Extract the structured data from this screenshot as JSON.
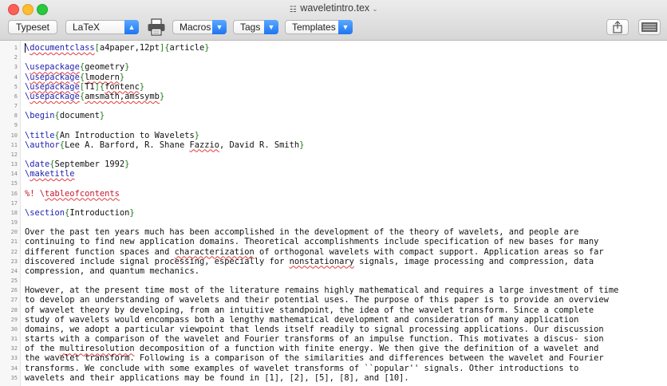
{
  "window": {
    "title": "waveletintro.tex"
  },
  "toolbar": {
    "typeset_label": "Typeset",
    "engine_value": "LaTeX",
    "macros_label": "Macros",
    "tags_label": "Tags",
    "templates_label": "Templates"
  },
  "editor": {
    "lines": [
      {
        "num": "1",
        "parts": [
          {
            "cls": "cmd",
            "t": "\\"
          },
          {
            "cls": "cmd squig",
            "t": "documentclass"
          },
          {
            "cls": "brace",
            "t": "["
          },
          {
            "cls": "arg",
            "t": "a4paper,12pt"
          },
          {
            "cls": "brace",
            "t": "]{"
          },
          {
            "cls": "arg",
            "t": "article"
          },
          {
            "cls": "brace",
            "t": "}"
          }
        ]
      },
      {
        "num": "2",
        "parts": []
      },
      {
        "num": "3",
        "parts": [
          {
            "cls": "cmd",
            "t": "\\"
          },
          {
            "cls": "cmd squig",
            "t": "usepackage"
          },
          {
            "cls": "brace",
            "t": "{"
          },
          {
            "cls": "arg",
            "t": "geometry"
          },
          {
            "cls": "brace",
            "t": "}"
          }
        ]
      },
      {
        "num": "4",
        "parts": [
          {
            "cls": "cmd",
            "t": "\\"
          },
          {
            "cls": "cmd squig",
            "t": "usepackage"
          },
          {
            "cls": "brace",
            "t": "{"
          },
          {
            "cls": "arg squig",
            "t": "lmodern"
          },
          {
            "cls": "brace",
            "t": "}"
          }
        ]
      },
      {
        "num": "5",
        "parts": [
          {
            "cls": "cmd",
            "t": "\\"
          },
          {
            "cls": "cmd squig",
            "t": "usepackage"
          },
          {
            "cls": "brace",
            "t": "["
          },
          {
            "cls": "arg",
            "t": "T1"
          },
          {
            "cls": "brace",
            "t": "]{"
          },
          {
            "cls": "arg squig",
            "t": "fontenc"
          },
          {
            "cls": "brace",
            "t": "}"
          }
        ]
      },
      {
        "num": "6",
        "parts": [
          {
            "cls": "cmd",
            "t": "\\"
          },
          {
            "cls": "cmd squig",
            "t": "usepackage"
          },
          {
            "cls": "brace",
            "t": "{"
          },
          {
            "cls": "arg squig",
            "t": "amsmath,amssymb"
          },
          {
            "cls": "brace",
            "t": "}"
          }
        ]
      },
      {
        "num": "7",
        "parts": []
      },
      {
        "num": "8",
        "parts": [
          {
            "cls": "cmd",
            "t": "\\begin"
          },
          {
            "cls": "brace",
            "t": "{"
          },
          {
            "cls": "arg",
            "t": "document"
          },
          {
            "cls": "brace",
            "t": "}"
          }
        ]
      },
      {
        "num": "9",
        "parts": []
      },
      {
        "num": "10",
        "parts": [
          {
            "cls": "cmd",
            "t": "\\title"
          },
          {
            "cls": "brace",
            "t": "{"
          },
          {
            "cls": "arg",
            "t": "An Introduction to Wavelets"
          },
          {
            "cls": "brace",
            "t": "}"
          }
        ]
      },
      {
        "num": "11",
        "parts": [
          {
            "cls": "cmd",
            "t": "\\author"
          },
          {
            "cls": "brace",
            "t": "{"
          },
          {
            "cls": "arg",
            "t": "Lee A. Barford, R. Shane "
          },
          {
            "cls": "arg squig",
            "t": "Fazzio"
          },
          {
            "cls": "arg",
            "t": ", David R. Smith"
          },
          {
            "cls": "brace",
            "t": "}"
          }
        ]
      },
      {
        "num": "12",
        "parts": []
      },
      {
        "num": "13",
        "parts": [
          {
            "cls": "cmd",
            "t": "\\date"
          },
          {
            "cls": "brace",
            "t": "{"
          },
          {
            "cls": "arg",
            "t": "September 1992"
          },
          {
            "cls": "brace",
            "t": "}"
          }
        ]
      },
      {
        "num": "14",
        "parts": [
          {
            "cls": "cmd",
            "t": "\\"
          },
          {
            "cls": "cmd squig",
            "t": "maketitle"
          }
        ]
      },
      {
        "num": "15",
        "parts": []
      },
      {
        "num": "16",
        "parts": [
          {
            "cls": "comment",
            "t": "%! \\"
          },
          {
            "cls": "comment squig",
            "t": "tableofcontents"
          }
        ]
      },
      {
        "num": "17",
        "parts": []
      },
      {
        "num": "18",
        "parts": [
          {
            "cls": "cmd",
            "t": "\\section"
          },
          {
            "cls": "brace",
            "t": "{"
          },
          {
            "cls": "arg",
            "t": "Introduction"
          },
          {
            "cls": "brace",
            "t": "}"
          }
        ]
      },
      {
        "num": "19",
        "parts": []
      },
      {
        "num": "20",
        "parts": [
          {
            "cls": "arg",
            "t": "Over the past ten years much has been accomplished in the development of the theory of wavelets, and people are"
          }
        ]
      },
      {
        "num": "21",
        "parts": [
          {
            "cls": "arg",
            "t": "continuing to find new application domains. Theoretical accomplishments include specification of new bases for many"
          }
        ]
      },
      {
        "num": "22",
        "parts": [
          {
            "cls": "arg",
            "t": "different function spaces and "
          },
          {
            "cls": "arg squig",
            "t": "characterization"
          },
          {
            "cls": "arg",
            "t": " of orthogonal wavelets with compact support. Application areas so far"
          }
        ]
      },
      {
        "num": "23",
        "parts": [
          {
            "cls": "arg",
            "t": "discovered include signal processing, especially for "
          },
          {
            "cls": "arg squig",
            "t": "nonstationary"
          },
          {
            "cls": "arg",
            "t": " signals, image processing and compression, data"
          }
        ]
      },
      {
        "num": "24",
        "parts": [
          {
            "cls": "arg",
            "t": "compression, and quantum mechanics."
          }
        ]
      },
      {
        "num": "25",
        "parts": []
      },
      {
        "num": "26",
        "parts": [
          {
            "cls": "arg",
            "t": "However, at the present time most of the literature remains highly mathematical and requires a large investment of time"
          }
        ]
      },
      {
        "num": "27",
        "parts": [
          {
            "cls": "arg",
            "t": "to develop an understanding of wavelets and their potential uses. The purpose of this paper is to provide an overview"
          }
        ]
      },
      {
        "num": "28",
        "parts": [
          {
            "cls": "arg",
            "t": "of wavelet theory by developing, from an intuitive standpoint, the idea of the wavelet transform. Since a complete"
          }
        ]
      },
      {
        "num": "29",
        "parts": [
          {
            "cls": "arg",
            "t": "study of wavelets would encompass both a lengthy mathematical development and consideration of many application"
          }
        ]
      },
      {
        "num": "30",
        "parts": [
          {
            "cls": "arg",
            "t": "domains, we adopt a particular viewpoint that lends itself readily to signal processing applications. Our discussion"
          }
        ]
      },
      {
        "num": "31",
        "parts": [
          {
            "cls": "arg",
            "t": "starts with a comparison of the wavelet and Fourier transforms of an impulse function. This motivates a discus- sion"
          }
        ]
      },
      {
        "num": "32",
        "parts": [
          {
            "cls": "arg",
            "t": "of the "
          },
          {
            "cls": "arg squig",
            "t": "multiresolution"
          },
          {
            "cls": "arg",
            "t": " decomposition of a function with finite energy. We then give the definition of a wavelet and"
          }
        ]
      },
      {
        "num": "33",
        "parts": [
          {
            "cls": "arg",
            "t": "the wavelet transform. Following is a comparison of the similarities and differences between the wavelet and Fourier"
          }
        ]
      },
      {
        "num": "34",
        "parts": [
          {
            "cls": "arg",
            "t": "transforms. We conclude with some examples of wavelet transforms of ``popular'' signals. Other introductions to"
          }
        ]
      },
      {
        "num": "35",
        "parts": [
          {
            "cls": "arg",
            "t": "wavelets and their applications may be found in [1], [2], [5], [8], and [10]."
          }
        ]
      }
    ]
  }
}
